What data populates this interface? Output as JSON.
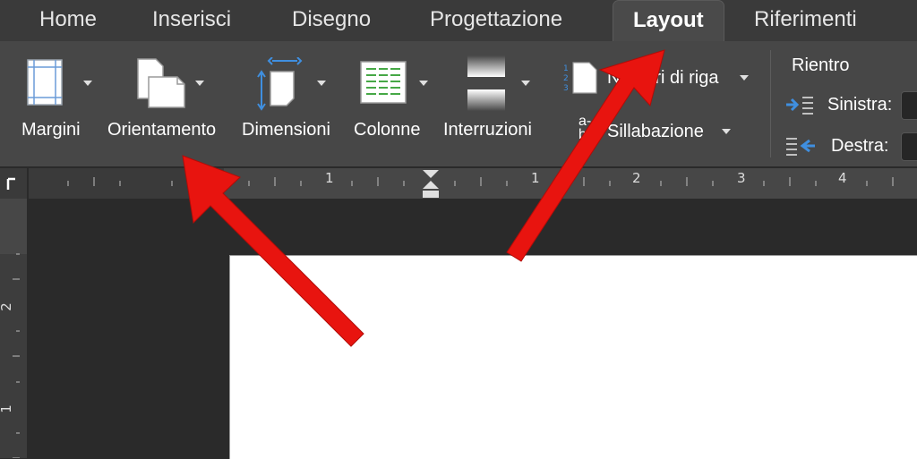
{
  "tabs": [
    {
      "label": "Home",
      "active": false
    },
    {
      "label": "Inserisci",
      "active": false
    },
    {
      "label": "Disegno",
      "active": false
    },
    {
      "label": "Progettazione",
      "active": false
    },
    {
      "label": "Layout",
      "active": true
    },
    {
      "label": "Riferimenti",
      "active": false
    }
  ],
  "ribbon": {
    "margini": "Margini",
    "orientamento": "Orientamento",
    "dimensioni": "Dimensioni",
    "colonne": "Colonne",
    "interruzioni": "Interruzioni",
    "numeri_di_riga": "Numeri di riga",
    "sillabazione": "Sillabazione",
    "sillabazione_icon_text": "a-\nbc",
    "rientro": {
      "title": "Rientro",
      "sinistra": "Sinistra:",
      "destra": "Destra:"
    }
  },
  "ruler": {
    "horizontal_labels": [
      "2",
      "1",
      "1",
      "2",
      "3",
      "4"
    ],
    "vertical_labels": [
      "2",
      "1"
    ]
  },
  "colors": {
    "annotation_arrow": "#e8140f",
    "ribbon_bg": "#474747",
    "tabbar_bg": "#3a3a3a"
  }
}
